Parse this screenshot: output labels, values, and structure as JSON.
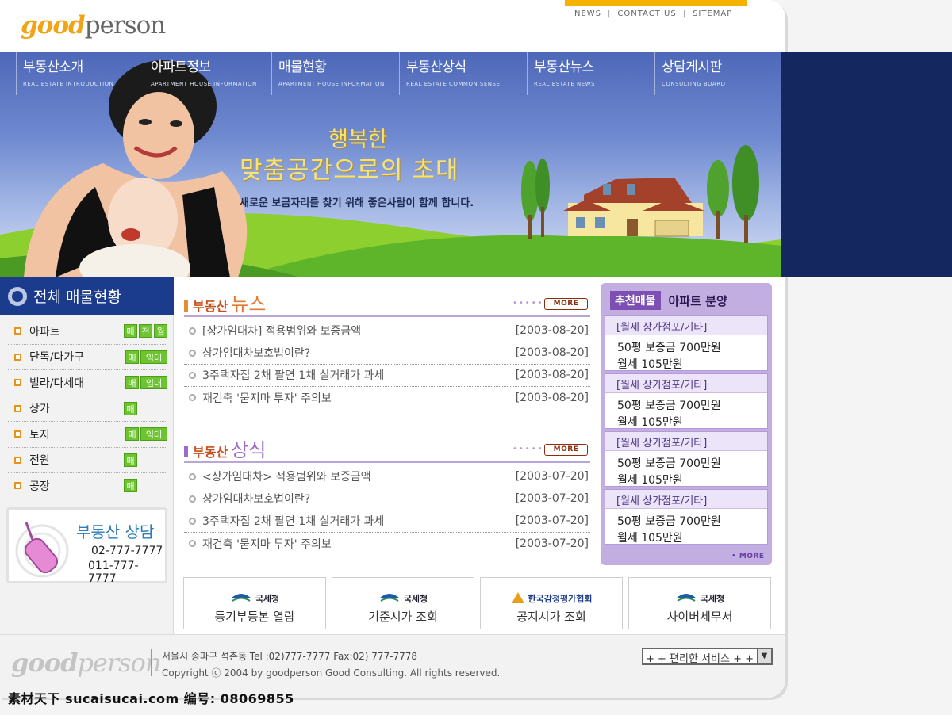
{
  "header": {
    "logo_good": "good",
    "logo_person": "person",
    "links": [
      "NEWS",
      "CONTACT US",
      "SITEMAP"
    ],
    "accent": "#f5b300"
  },
  "nav": [
    {
      "ko": "부동산소개",
      "en": "REAL ESTATE INTRODUCTION"
    },
    {
      "ko": "아파트정보",
      "en": "APARTMENT HOUSE INFORMATION"
    },
    {
      "ko": "매물현황",
      "en": "APARTMENT HOUSE INFORMATION"
    },
    {
      "ko": "부동산상식",
      "en": "REAL ESTATE COMMON SENSE"
    },
    {
      "ko": "부동산뉴스",
      "en": "REAL ESTATE NEWS"
    },
    {
      "ko": "상담게시판",
      "en": "CONSULTING BOARD"
    }
  ],
  "hero": {
    "line1": "행복한",
    "line2": "맞춤공간으로의 초대",
    "line3": "새로운 보금자리를 찾기 위해 좋은사람이 함께 합니다."
  },
  "sidebar": {
    "title": "전체 매물현황",
    "categories": [
      {
        "name": "아파트",
        "tags": [
          "매",
          "전",
          "월"
        ]
      },
      {
        "name": "단독/다가구",
        "tags": [
          "매",
          "임대"
        ]
      },
      {
        "name": "빌라/다세대",
        "tags": [
          "매",
          "임대"
        ]
      },
      {
        "name": "상가",
        "tags": [
          "매"
        ]
      },
      {
        "name": "토지",
        "tags": [
          "매",
          "임대"
        ]
      },
      {
        "name": "전원",
        "tags": [
          "매"
        ]
      },
      {
        "name": "공장",
        "tags": [
          "매"
        ]
      }
    ],
    "consult": {
      "title": "부동산 상담",
      "phone1": "02-777-7777",
      "phone2": "011-777-7777"
    }
  },
  "news": {
    "label": "부동산",
    "title": "뉴스",
    "more": "MORE",
    "items": [
      {
        "title": "[상가임대차] 적용범위와 보증금액",
        "date": "[2003-08-20]"
      },
      {
        "title": "상가임대차보호법이란?",
        "date": "[2003-08-20]"
      },
      {
        "title": "3주택자집 2채 팔면 1채 실거래가 과세",
        "date": "[2003-08-20]"
      },
      {
        "title": "재건축 '묻지마 투자' 주의보",
        "date": "[2003-08-20]"
      }
    ]
  },
  "knowledge": {
    "label": "부동산",
    "title": "상식",
    "more": "MORE",
    "items": [
      {
        "title": "<상가임대차> 적용범위와 보증금액",
        "date": "[2003-07-20]"
      },
      {
        "title": "상가임대차보호법이란?",
        "date": "[2003-07-20]"
      },
      {
        "title": "3주택자집 2채 팔면 1채 실거래가 과세",
        "date": "[2003-07-20]"
      },
      {
        "title": "재건축 '묻지마 투자' 주의보",
        "date": "[2003-07-20]"
      }
    ]
  },
  "recommend": {
    "badge": "추천매물",
    "subtitle": "아파트 분양",
    "more": "• MORE",
    "items": [
      {
        "head": "[월세 상가점포/기타]",
        "line1": "50평 보증금 700만원",
        "line2": "월세 105만원"
      },
      {
        "head": "[월세 상가점포/기타]",
        "line1": "50평 보증금 700만원",
        "line2": "월세 105만원"
      },
      {
        "head": "[월세 상가점포/기타]",
        "line1": "50평 보증금 700만원",
        "line2": "월세 105만원"
      },
      {
        "head": "[월세 상가점포/기타]",
        "line1": "50평 보증금 700만원",
        "line2": "월세 105만원"
      }
    ]
  },
  "links": [
    {
      "org": "국세청",
      "label": "등기부등본 열람"
    },
    {
      "org": "국세청",
      "label": "기준시가 조회"
    },
    {
      "org": "한국감정평가협회",
      "label": "공지시가 조회"
    },
    {
      "org": "국세청",
      "label": "사이버세무서"
    }
  ],
  "footer": {
    "logo_good": "good",
    "logo_person": "person",
    "address": "서울시 송파구 석촌동   Tel :02)777-7777    Fax:02) 777-7778",
    "copyright": "Copyright ⓒ 2004 by goodperson Good Consulting. All rights reserved.",
    "select_value": "+ + 편리한 서비스 + +"
  },
  "watermark": "素材天下 sucaisucai.com   编号: 08069855"
}
